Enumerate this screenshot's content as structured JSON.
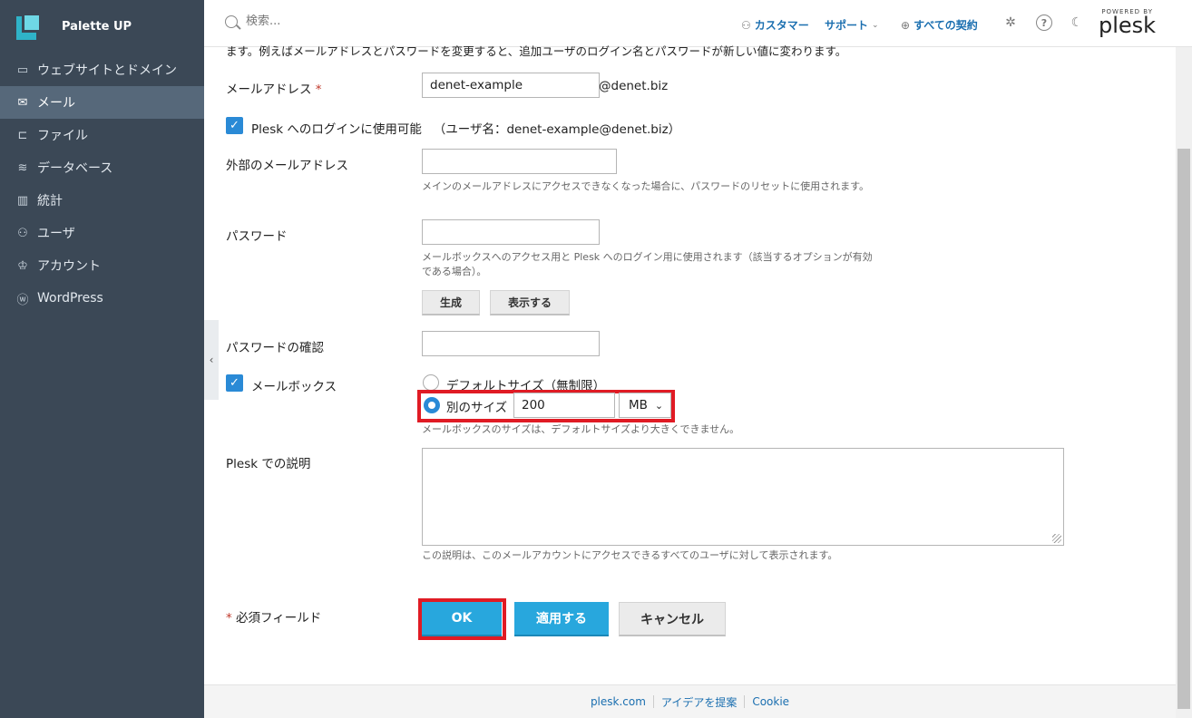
{
  "sidebar": {
    "brand": "Palette UP",
    "items": [
      {
        "label": "ウェブサイトとドメイン",
        "icon": "monitor-icon"
      },
      {
        "label": "メール",
        "icon": "mail-icon",
        "active": true
      },
      {
        "label": "ファイル",
        "icon": "folder-icon"
      },
      {
        "label": "データベース",
        "icon": "database-icon"
      },
      {
        "label": "統計",
        "icon": "stats-icon"
      },
      {
        "label": "ユーザ",
        "icon": "user-icon"
      },
      {
        "label": "アカウント",
        "icon": "account-icon"
      },
      {
        "label": "WordPress",
        "icon": "wordpress-icon"
      }
    ]
  },
  "header": {
    "search_placeholder": "検索...",
    "customer_label": "カスタマー",
    "support_label": "サポート",
    "subscriptions_label": "すべての契約",
    "powered_by": "POWERED BY",
    "plesk": "plesk"
  },
  "form": {
    "intro": "ます。例えばメールアドレスとパスワードを変更すると、追加ユーザのログイン名とパスワードが新しい値に変わります。",
    "email_label": "メールアドレス",
    "required_mark": "*",
    "email_value": "denet-example",
    "email_domain": "@denet.biz",
    "plesk_login_label": "Plesk へのログインに使用可能",
    "plesk_login_user": "（ユーザ名：denet-example@denet.biz）",
    "external_email_label": "外部のメールアドレス",
    "external_email_hint": "メインのメールアドレスにアクセスできなくなった場合に、パスワードのリセットに使用されます。",
    "password_label": "パスワード",
    "password_hint": "メールボックスへのアクセス用と Plesk へのログイン用に使用されます（該当するオプションが有効である場合）。",
    "generate_button": "生成",
    "show_button": "表示する",
    "password_confirm_label": "パスワードの確認",
    "mailbox_label": "メールボックス",
    "default_size_label": "デフォルトサイズ（無制限）",
    "other_size_label": "別のサイズ",
    "size_value": "200",
    "size_unit": "MB",
    "mailbox_hint": "メールボックスのサイズは、デフォルトサイズより大きくできません。",
    "description_label": "Plesk での説明",
    "description_hint": "この説明は、このメールアカウントにアクセスできるすべてのユーザに対して表示されます。",
    "required_fields_label": "必須フィールド",
    "ok_button": "OK",
    "apply_button": "適用する",
    "cancel_button": "キャンセル"
  },
  "footer": {
    "links": [
      "plesk.com",
      "アイデアを提案",
      "Cookie"
    ]
  },
  "colors": {
    "sidebar_bg": "#3b4856",
    "accent": "#28a7dd",
    "link": "#1b6fb0",
    "highlight": "#e01b24"
  }
}
